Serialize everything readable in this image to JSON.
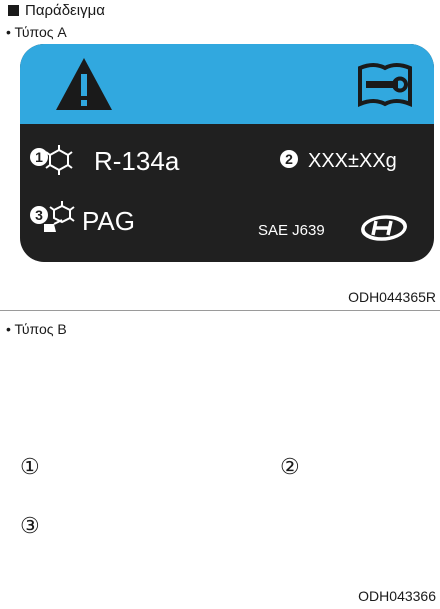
{
  "heading": "Παράδειγμα",
  "type_a": {
    "label": "• Τύπος A",
    "refrigerant_marker": "1",
    "refrigerant": "R-134a",
    "amount_marker": "2",
    "amount": "XXX±XXg",
    "oil_marker": "3",
    "oil": "PAG",
    "standard": "SAE J639",
    "code": "ODH044365R",
    "colors": {
      "band": "#31a8df",
      "panel": "#202020"
    }
  },
  "type_b": {
    "label": "• Τύπος B",
    "marker_1": "①",
    "marker_2": "②",
    "marker_3": "③",
    "code": "ODH043366"
  }
}
